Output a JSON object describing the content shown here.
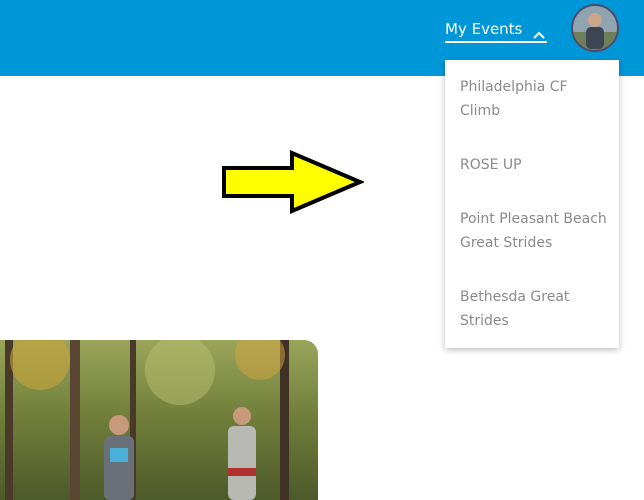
{
  "header": {
    "my_events_label": "My Events",
    "accent_color": "#0097d8"
  },
  "events_dropdown": {
    "items": [
      "Philadelphia CF Climb",
      "ROSE UP",
      "Point Pleasant Beach Great Strides",
      "Bethesda Great Strides"
    ]
  },
  "annotation": {
    "arrow_color": "#ffff00",
    "arrow_direction": "right"
  },
  "icons": {
    "my_events_toggle": "chevron-up-icon"
  }
}
